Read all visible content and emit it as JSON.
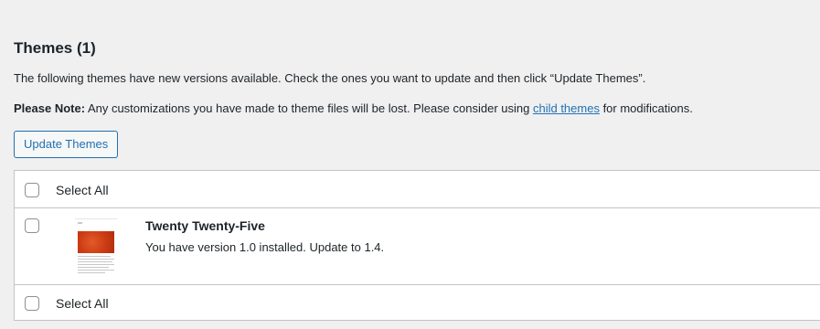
{
  "section": {
    "title": "Themes (1)",
    "description": "The following themes have new versions available. Check the ones you want to update and then click “Update Themes”.",
    "note_label": "Please Note:",
    "note_text_before": " Any customizations you have made to theme files will be lost. Please consider using ",
    "note_link": "child themes",
    "note_text_after": " for modifications."
  },
  "actions": {
    "update_button": "Update Themes"
  },
  "table": {
    "select_all_top": "Select All",
    "select_all_bottom": "Select All",
    "themes": [
      {
        "name": "Twenty Twenty-Five",
        "status": "You have version 1.0 installed. Update to 1.4.",
        "checked": false
      }
    ]
  },
  "colors": {
    "page_bg": "#f0f0f1",
    "accent": "#2271b1",
    "border": "#c3c4c7",
    "thumbnail_hero": "#cc3b14"
  }
}
